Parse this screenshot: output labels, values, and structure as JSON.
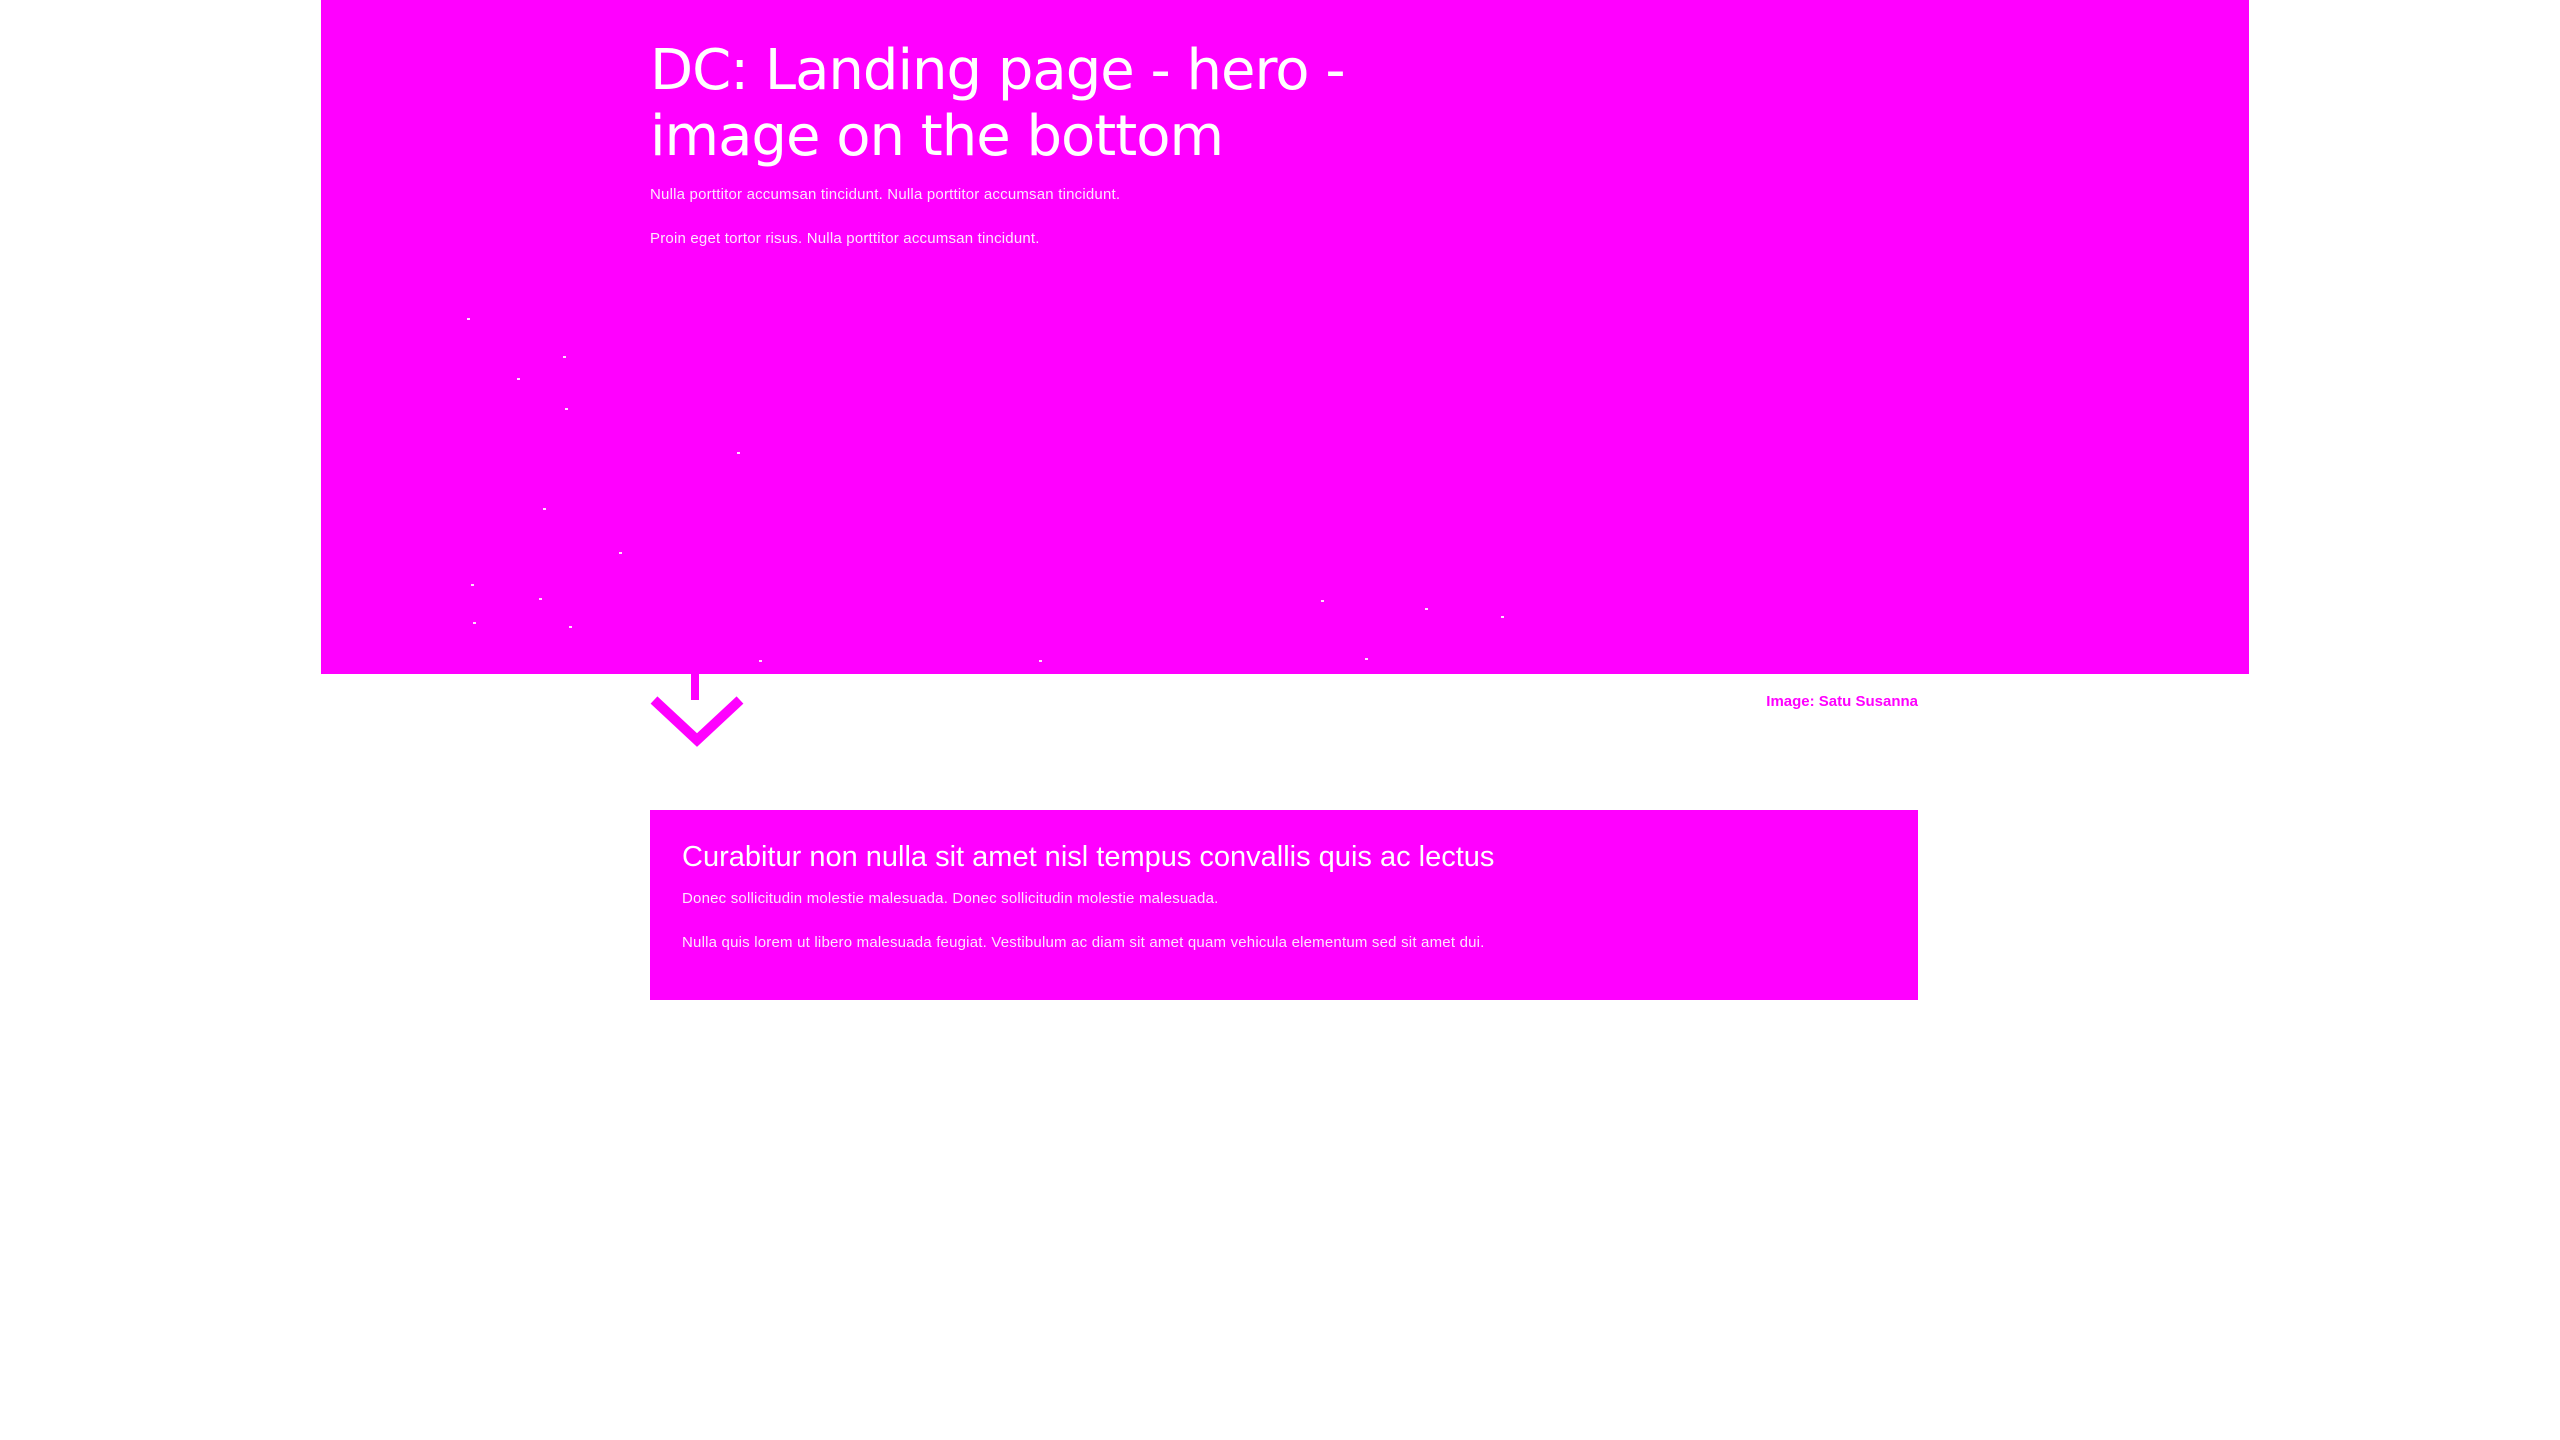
{
  "hero": {
    "title": "DC: Landing page - hero - image on the bottom",
    "paragraphs": [
      "Nulla porttitor accumsan tincidunt. Nulla porttitor accumsan tincidunt.",
      "Proin eget tortor risus. Nulla porttitor accumsan tincidunt."
    ],
    "background_color": "#ff00ff",
    "scroll_icon": "arrow-down-icon"
  },
  "image_credit": "Image: Satu Susanna",
  "callout": {
    "title": "Curabitur non nulla sit amet nisl tempus convallis quis ac lectus",
    "paragraphs": [
      "Donec sollicitudin molestie malesuada. Donec sollicitudin molestie malesuada.",
      "Nulla quis lorem ut libero malesuada feugiat. Vestibulum ac diam sit amet quam vehicula elementum sed sit amet dui."
    ],
    "background_color": "#ff00ff"
  },
  "colors": {
    "accent": "#ff00ff",
    "text_on_accent": "#ffffff",
    "page_background": "#ffffff"
  }
}
